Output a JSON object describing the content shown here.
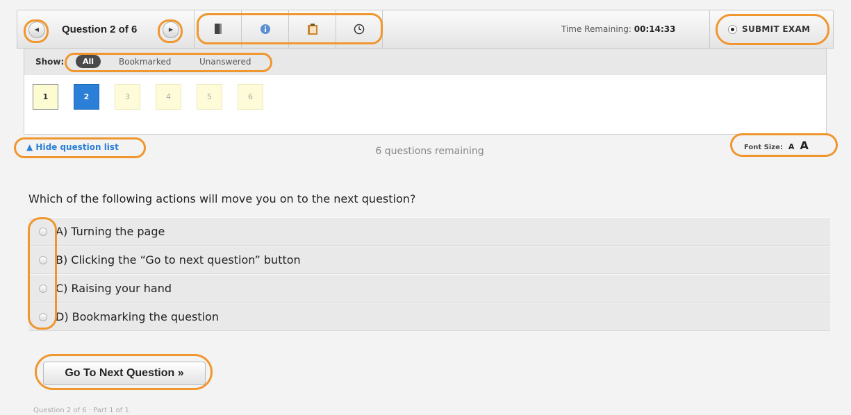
{
  "toolbar": {
    "prev_icon": "chevron-left-icon",
    "question_title": "Question 2 of 6",
    "next_icon": "chevron-right-icon",
    "tools": [
      {
        "name": "bookmark-icon"
      },
      {
        "name": "info-icon"
      },
      {
        "name": "notepad-icon"
      },
      {
        "name": "clock-icon"
      }
    ],
    "time_label": "Time Remaining:",
    "time_value": "00:14:33",
    "submit_label": "SUBMIT EXAM"
  },
  "filter": {
    "show_label": "Show:",
    "all_label": "All",
    "bookmarked_label": "Bookmarked",
    "unanswered_label": "Unanswered"
  },
  "question_list": [
    {
      "number": "1",
      "state": "visited"
    },
    {
      "number": "2",
      "state": "current"
    },
    {
      "number": "3",
      "state": "pending"
    },
    {
      "number": "4",
      "state": "pending"
    },
    {
      "number": "5",
      "state": "pending"
    },
    {
      "number": "6",
      "state": "pending"
    }
  ],
  "hide_list_label": "▲ Hide question list",
  "remaining_text": "6 questions remaining",
  "font_size": {
    "label": "Font Size:",
    "small": "A",
    "large": "A"
  },
  "question": {
    "text": "Which of the following actions will move you on to the next question?",
    "options": [
      "A) Turning the page",
      "B) Clicking the “Go to next question” button",
      "C) Raising your hand",
      "D) Bookmarking the question"
    ]
  },
  "next_button_label": "Go To Next Question »",
  "footer": "Question 2 of 6 · Part 1 of 1",
  "colors": {
    "accent": "#2b7fd6",
    "highlight_ring": "#f0962e",
    "current_box": "#2b7fd6",
    "box_bg": "#fdfbd2"
  }
}
